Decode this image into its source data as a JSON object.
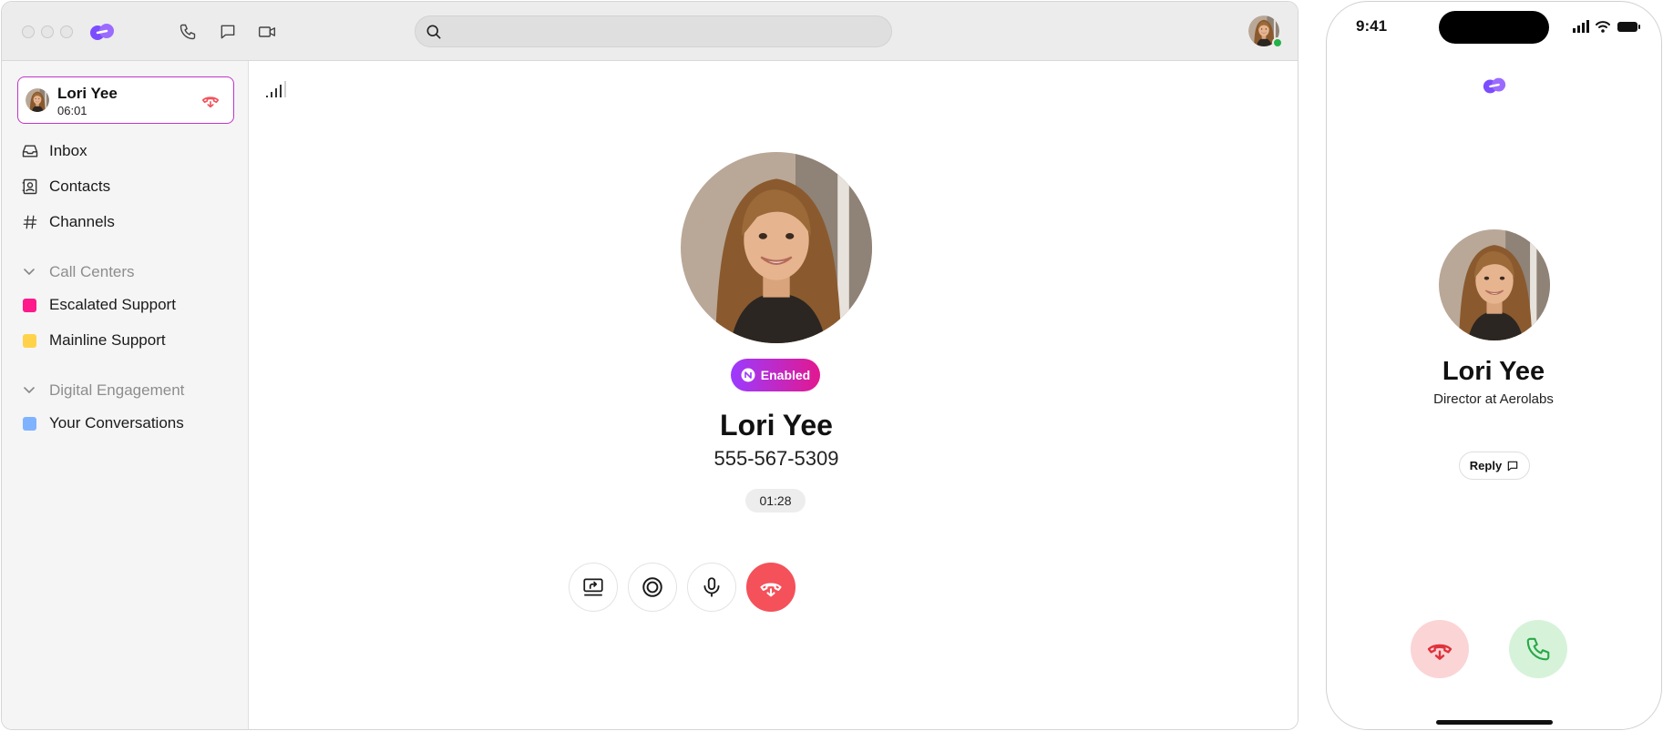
{
  "window": {
    "traffic_lights": [
      "close",
      "minimize",
      "zoom"
    ],
    "toolbar_icons": [
      "phone-icon",
      "chat-icon",
      "video-icon"
    ],
    "search": {
      "placeholder": "",
      "value": ""
    },
    "accent_color": "#7b4dff"
  },
  "sidebar": {
    "active_call": {
      "name": "Lori Yee",
      "duration": "06:01",
      "border_color": "#c233c9"
    },
    "nav": [
      {
        "label": "Inbox",
        "icon": "inbox-icon"
      },
      {
        "label": "Contacts",
        "icon": "contacts-icon"
      },
      {
        "label": "Channels",
        "icon": "hash-icon"
      }
    ],
    "sections": [
      {
        "label": "Call Centers",
        "items": [
          {
            "label": "Escalated Support",
            "color": "#ff1a8c"
          },
          {
            "label": "Mainline Support",
            "color": "#ffd24a"
          }
        ]
      },
      {
        "label": "Digital Engagement",
        "items": [
          {
            "label": "Your Conversations",
            "color": "#7fb3ff"
          }
        ]
      }
    ]
  },
  "call": {
    "badge": "Enabled",
    "name": "Lori Yee",
    "phone": "555-567-5309",
    "timer": "01:28",
    "controls": [
      "share-screen-icon",
      "record-icon",
      "microphone-icon",
      "hang-up-icon"
    ],
    "end_color": "#f4515a"
  },
  "phone": {
    "time": "9:41",
    "name": "Lori Yee",
    "title": "Director at Aerolabs",
    "reply_label": "Reply",
    "decline_color": "#fbd4d6",
    "accept_color": "#d6f3d9"
  }
}
